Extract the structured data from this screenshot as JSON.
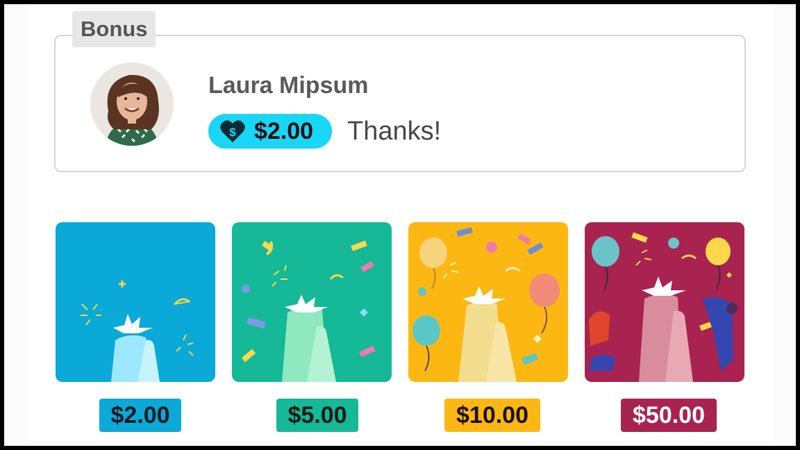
{
  "bonus": {
    "tag_label": "Bonus",
    "sender_name": "Laura Mipsum",
    "amount": "$2.00",
    "message": "Thanks!",
    "badge_icon": "heart-dollar-icon",
    "pill_color": "#19d6f6"
  },
  "options": [
    {
      "price": "$2.00",
      "color": "#0aa9d7",
      "label_bg": "#0aa9d7",
      "label_fg": "#0b1a22"
    },
    {
      "price": "$5.00",
      "color": "#15b897",
      "label_bg": "#15b897",
      "label_fg": "#0b1a16"
    },
    {
      "price": "$10.00",
      "color": "#fdb713",
      "label_bg": "#fdb713",
      "label_fg": "#1a1203"
    },
    {
      "price": "$50.00",
      "color": "#a8234f",
      "label_bg": "#a8234f",
      "label_fg": "#ffffff"
    }
  ]
}
